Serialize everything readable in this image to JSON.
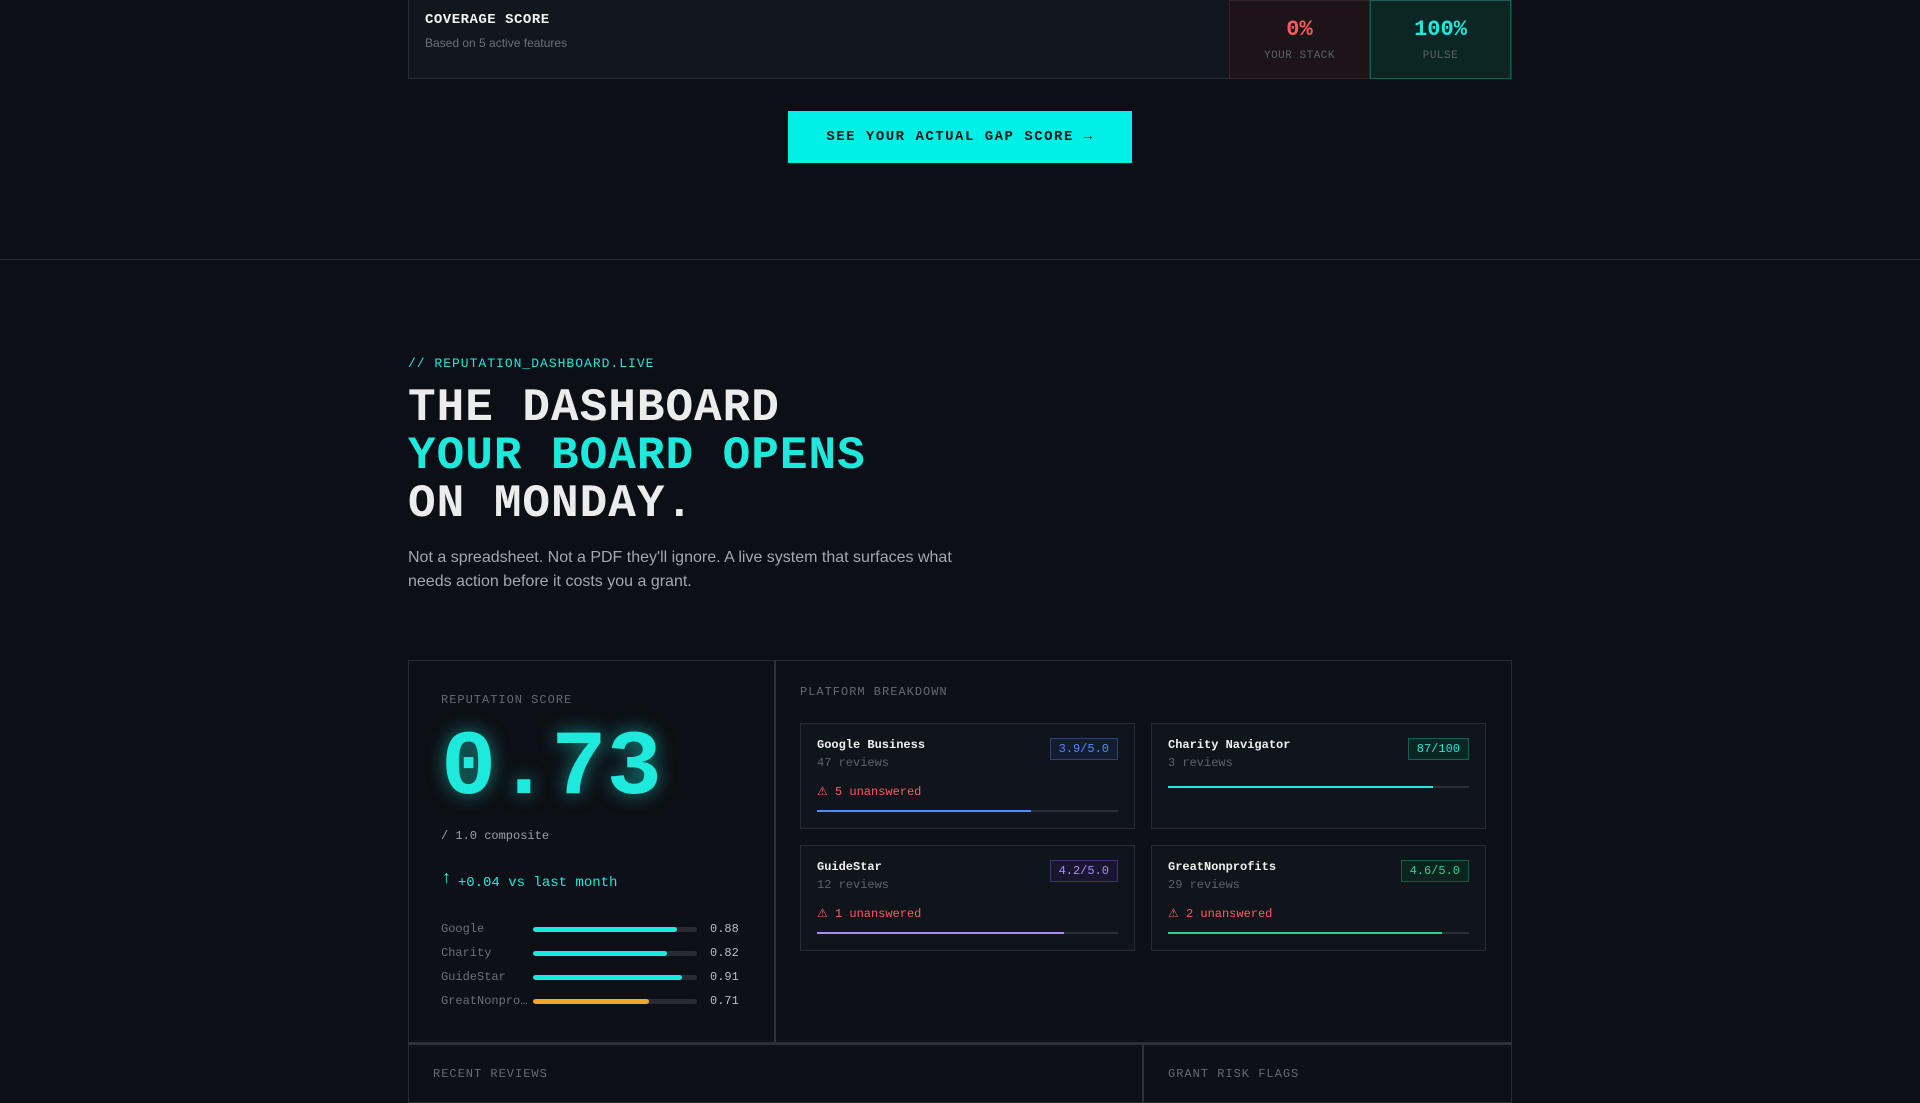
{
  "coverage": {
    "title": "COVERAGE SCORE",
    "subtitle": "Based on 5 active features",
    "stack_value": "0%",
    "stack_label": "YOUR STACK",
    "pulse_value": "100%",
    "pulse_label": "PULSE"
  },
  "cta": {
    "label": "SEE YOUR ACTUAL GAP SCORE →"
  },
  "hero": {
    "eyebrow": "// REPUTATION_DASHBOARD.LIVE",
    "line1": "THE DASHBOARD",
    "line2": "YOUR BOARD OPENS",
    "line3": "ON MONDAY.",
    "lead": "Not a spreadsheet. Not a PDF they'll ignore. A live system that surfaces what needs action before it costs you a grant."
  },
  "reputation": {
    "label": "REPUTATION SCORE",
    "score": "0.73",
    "composite": "/ 1.0 composite",
    "delta_arrow": "↑",
    "delta": "+0.04 vs last month",
    "bars": [
      {
        "name": "Google",
        "value": "0.88",
        "fraction": 0.88,
        "color": "#1de9dd"
      },
      {
        "name": "Charity",
        "value": "0.82",
        "fraction": 0.82,
        "color": "#1de9dd"
      },
      {
        "name": "GuideStar",
        "value": "0.91",
        "fraction": 0.91,
        "color": "#1de9dd"
      },
      {
        "name": "GreatNonprofits",
        "value": "0.71",
        "fraction": 0.71,
        "color": "#f5a623"
      }
    ]
  },
  "platforms": {
    "label": "PLATFORM BREAKDOWN",
    "cards": [
      {
        "name": "Google Business",
        "reviews": "47 reviews",
        "rating": "3.9/5.0",
        "alert": "⚠ 5 unanswered",
        "fraction": 0.71,
        "color": "#4f8cff",
        "badge_bg": "#141c30",
        "badge_border": "#2c4270"
      },
      {
        "name": "Charity Navigator",
        "reviews": "3 reviews",
        "rating": "87/100",
        "alert": "",
        "fraction": 0.88,
        "color": "#1de9dd",
        "badge_bg": "#0c2624",
        "badge_border": "#1a5c56"
      },
      {
        "name": "GuideStar",
        "reviews": "12 reviews",
        "rating": "4.2/5.0",
        "alert": "⚠ 1 unanswered",
        "fraction": 0.82,
        "color": "#a78bfa",
        "badge_bg": "#1b1630",
        "badge_border": "#3e3470"
      },
      {
        "name": "GreatNonprofits",
        "reviews": "29 reviews",
        "rating": "4.6/5.0",
        "alert": "⚠ 2 unanswered",
        "fraction": 0.91,
        "color": "#2fd08a",
        "badge_bg": "#0c2420",
        "badge_border": "#1d5a45"
      }
    ]
  },
  "bottom": {
    "recent_reviews": "RECENT REVIEWS",
    "grant_risk": "GRANT RISK FLAGS"
  }
}
